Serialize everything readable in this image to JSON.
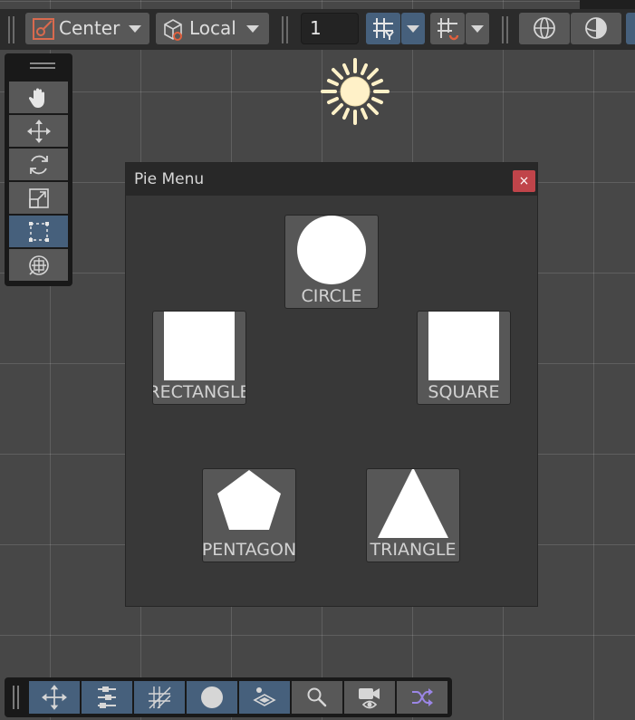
{
  "top_toolbar": {
    "pivot_mode_label": "Center",
    "pivot_rotation_label": "Local",
    "grid_snap_value": "1",
    "grid_snap_icon": "grid-snap-icon",
    "increment_snap_icon": "increment-snap-icon",
    "globe_icon": "globe-icon",
    "sphere_icon": "sphere-icon"
  },
  "tool_palette": {
    "tools": [
      {
        "name": "hand-tool",
        "icon": "hand-icon",
        "active": false
      },
      {
        "name": "move-tool",
        "icon": "move-icon",
        "active": false
      },
      {
        "name": "rotate-tool",
        "icon": "rotate-icon",
        "active": false
      },
      {
        "name": "scale-tool",
        "icon": "scale-icon",
        "active": false
      },
      {
        "name": "rect-tool",
        "icon": "rect-icon",
        "active": true
      },
      {
        "name": "transform-tool",
        "icon": "transform-icon",
        "active": false
      }
    ]
  },
  "pie_menu": {
    "title": "Pie Menu",
    "close_label": "×",
    "items": [
      {
        "label": "CIRCLE",
        "shape": "circle"
      },
      {
        "label": "RECTANGLE",
        "shape": "rectangle"
      },
      {
        "label": "SQUARE",
        "shape": "square"
      },
      {
        "label": "PENTAGON",
        "shape": "pentagon"
      },
      {
        "label": "TRIANGLE",
        "shape": "triangle"
      }
    ]
  },
  "bottom_toolbar": {
    "buttons": [
      {
        "icon": "move-arrows-icon",
        "active": true
      },
      {
        "icon": "sliders-icon",
        "active": true
      },
      {
        "icon": "grid-hatch-icon",
        "active": true
      },
      {
        "icon": "circle-icon",
        "active": true
      },
      {
        "icon": "layers-icon",
        "active": true
      },
      {
        "icon": "search-icon",
        "active": false
      },
      {
        "icon": "camera-eye-icon",
        "active": false
      },
      {
        "icon": "shuffle-icon",
        "active": false
      }
    ]
  },
  "colors": {
    "scene_bg": "#474747",
    "toolbar_bg": "#2b2b2b",
    "button": "#585858",
    "active_blue": "#46607c",
    "close_red": "#c0444a",
    "sun": "#fff1c8",
    "shuffle_purple": "#9b86e6"
  }
}
